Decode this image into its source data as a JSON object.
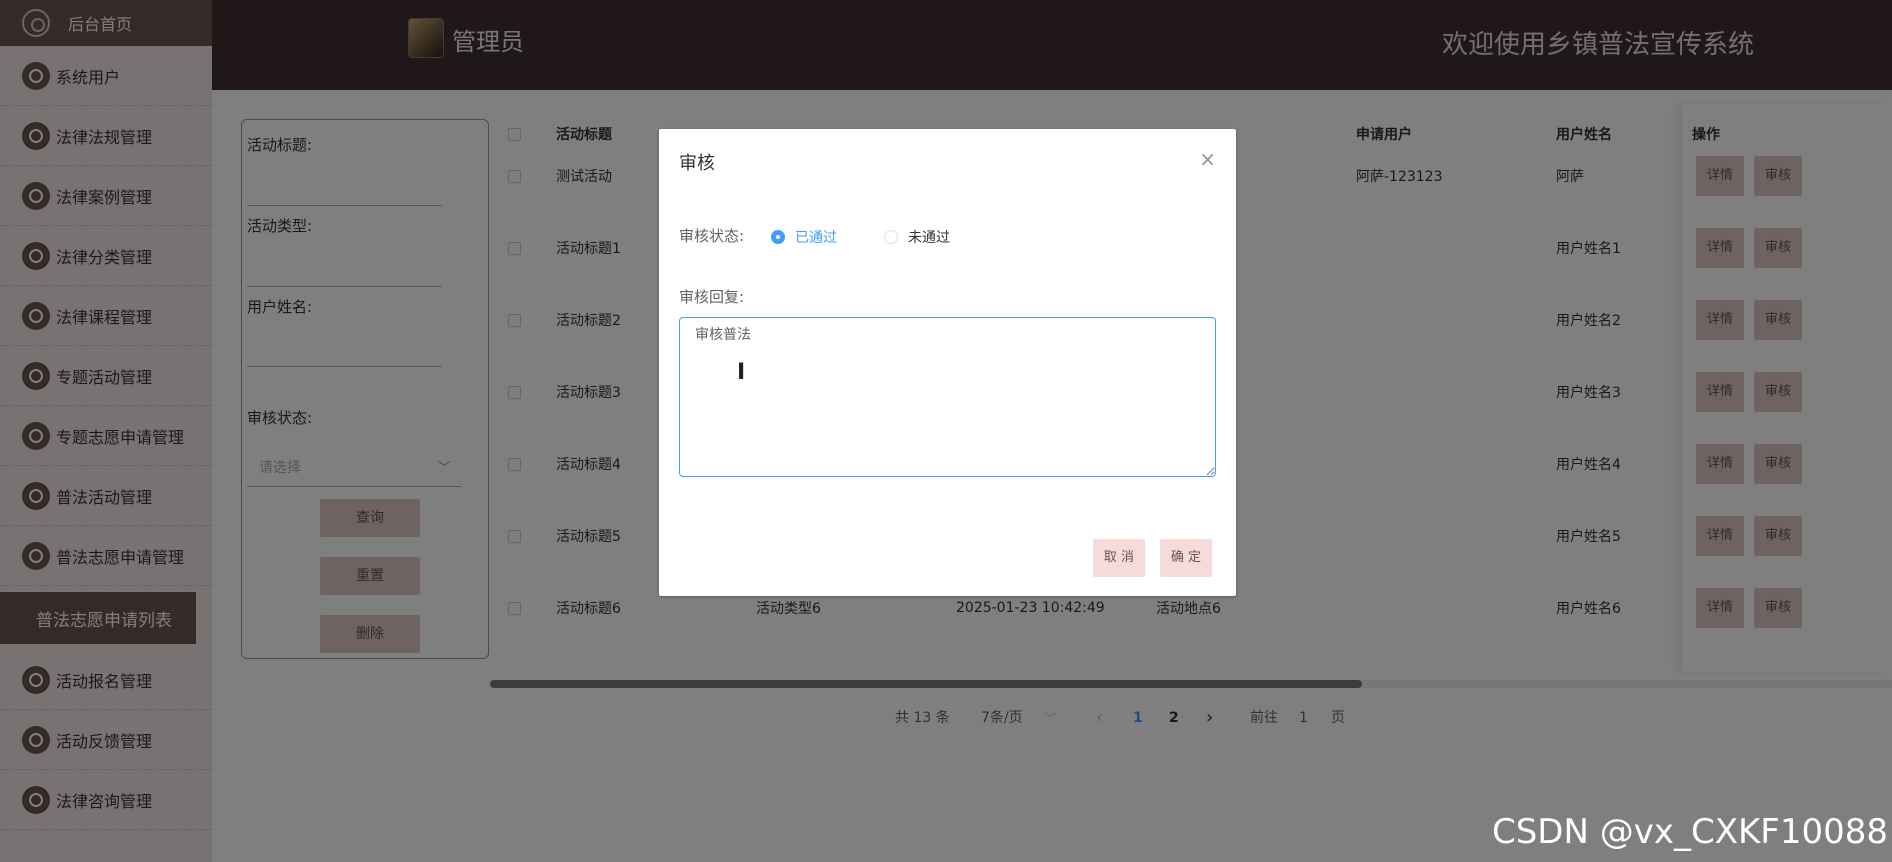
{
  "sidebar": {
    "home": "后台首页",
    "items": [
      {
        "label": "系统用户"
      },
      {
        "label": "法律法规管理"
      },
      {
        "label": "法律案例管理"
      },
      {
        "label": "法律分类管理"
      },
      {
        "label": "法律课程管理"
      },
      {
        "label": "专题活动管理"
      },
      {
        "label": "专题志愿申请管理"
      },
      {
        "label": "普法活动管理"
      },
      {
        "label": "普法志愿申请管理"
      }
    ],
    "active_sub": "普法志愿申请列表",
    "items_after": [
      {
        "label": "活动报名管理"
      },
      {
        "label": "活动反馈管理"
      },
      {
        "label": "法律咨询管理"
      }
    ]
  },
  "header": {
    "admin_name": "管理员",
    "system_title": "欢迎使用乡镇普法宣传系统"
  },
  "search": {
    "title_label": "活动标题:",
    "type_label": "活动类型:",
    "username_label": "用户姓名:",
    "status_label": "审核状态:",
    "status_placeholder": "请选择",
    "query_btn": "查询",
    "reset_btn": "重置",
    "delete_btn": "删除"
  },
  "table": {
    "headers": {
      "title": "活动标题",
      "apply_user": "申请用户",
      "user_name": "用户姓名",
      "ops": "操作"
    },
    "rows": [
      {
        "title": "测试活动",
        "type": "",
        "time": "",
        "place": "",
        "apply_user": "阿萨-123123",
        "user_name": "阿萨"
      },
      {
        "title": "活动标题1",
        "type": "",
        "time": "",
        "place": "",
        "apply_user": "",
        "user_name": "用户姓名1"
      },
      {
        "title": "活动标题2",
        "type": "",
        "time": "",
        "place": "",
        "apply_user": "",
        "user_name": "用户姓名2"
      },
      {
        "title": "活动标题3",
        "type": "",
        "time": "",
        "place": "",
        "apply_user": "",
        "user_name": "用户姓名3"
      },
      {
        "title": "活动标题4",
        "type": "",
        "time": "",
        "place": "",
        "apply_user": "",
        "user_name": "用户姓名4"
      },
      {
        "title": "活动标题5",
        "type": "",
        "time": "",
        "place": "",
        "apply_user": "",
        "user_name": "用户姓名5"
      },
      {
        "title": "活动标题6",
        "type": "活动类型6",
        "time": "2025-01-23 10:42:49",
        "place": "活动地点6",
        "apply_user": "",
        "user_name": "用户姓名6"
      }
    ],
    "detail_btn": "详情",
    "audit_btn": "审核"
  },
  "pagination": {
    "total": "共 13 条",
    "page_size": "7条/页",
    "prev": "‹",
    "page1": "1",
    "page2": "2",
    "next": "›",
    "goto_label": "前往",
    "goto_value": "1",
    "goto_unit": "页"
  },
  "dialog": {
    "title": "审核",
    "close": "×",
    "status_label": "审核状态:",
    "option_pass": "已通过",
    "option_fail": "未通过",
    "reply_label": "审核回复:",
    "reply_value": "审核普法",
    "cancel": "取 消",
    "confirm": "确 定"
  },
  "watermark": "CSDN @vx_CXKF10088"
}
